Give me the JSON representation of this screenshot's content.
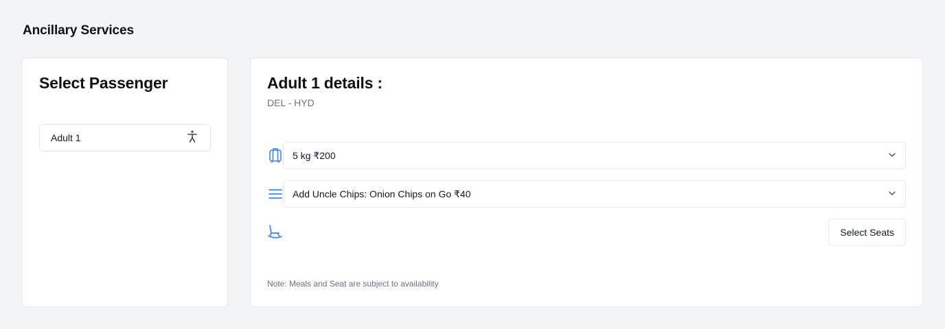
{
  "page": {
    "title": "Ancillary Services"
  },
  "passenger_panel": {
    "heading": "Select Passenger",
    "passengers": [
      {
        "label": "Adult 1",
        "icon": "person-icon"
      }
    ]
  },
  "details_panel": {
    "heading": "Adult 1 details :",
    "route": "DEL - HYD",
    "baggage": {
      "icon": "luggage-icon",
      "selected": "5 kg ₹200"
    },
    "meal": {
      "icon": "menu-lines-icon",
      "selected": "Add Uncle Chips: Onion Chips on Go ₹40"
    },
    "seat": {
      "icon": "seat-icon",
      "button_label": "Select Seats"
    },
    "note": "Note: Meals and Seat are subject to availability"
  },
  "colors": {
    "accent_icon": "#3b82f6",
    "background": "#f3f4f6",
    "card": "#ffffff",
    "border": "#e5e7eb",
    "muted_text": "#6b7280"
  }
}
